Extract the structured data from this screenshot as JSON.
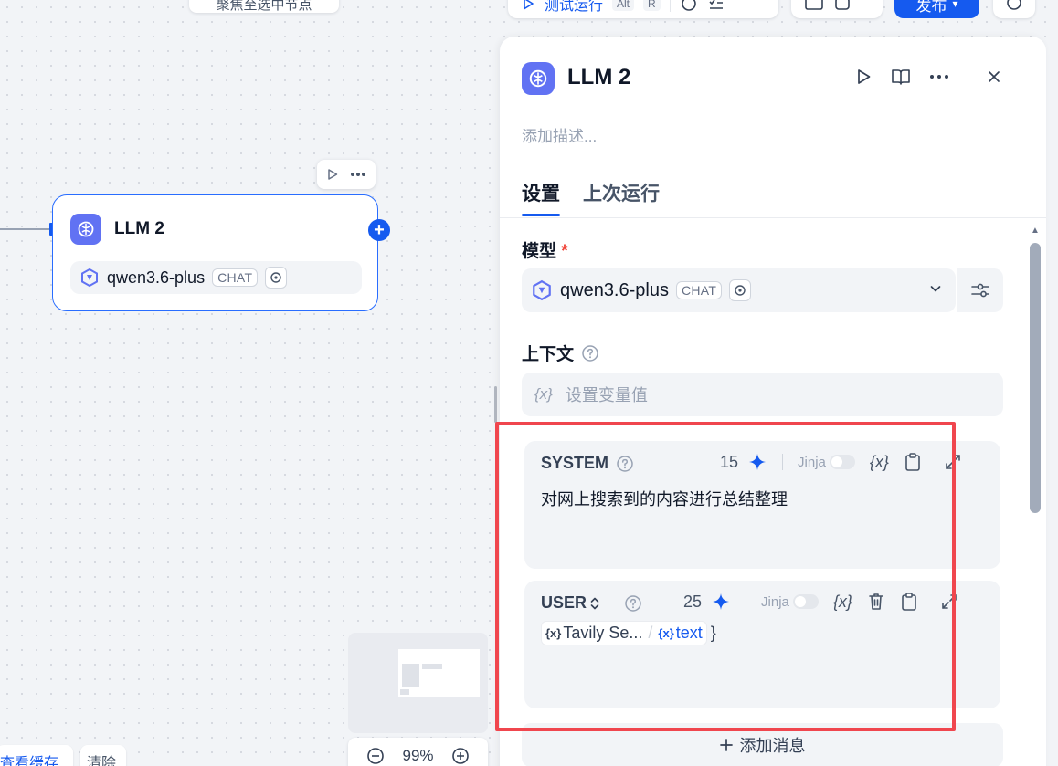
{
  "top": {
    "hint_text": "聚焦至选中节点",
    "run_label": "测试运行",
    "run_shortcut_alt": "Alt",
    "run_shortcut_r": "R",
    "publish_label": "发布"
  },
  "node": {
    "title": "LLM 2",
    "model_name": "qwen3.6-plus",
    "model_badge": "CHAT"
  },
  "canvas": {
    "view_cache_label": "查看缓存",
    "clear_label": "清除",
    "zoom_level": "99%"
  },
  "panel": {
    "title": "LLM 2",
    "description_placeholder": "添加描述...",
    "tabs": [
      "设置",
      "上次运行"
    ],
    "model_label": "模型",
    "required_mark": "*",
    "model_name": "qwen3.6-plus",
    "model_badge": "CHAT",
    "context_label": "上下文",
    "context_placeholder": "设置变量值",
    "add_message_label": "添加消息"
  },
  "messages": [
    {
      "role": "SYSTEM",
      "token_count": "15",
      "jinja_label": "Jinja",
      "content": "对网上搜索到的内容进行总结整理"
    },
    {
      "role": "USER",
      "token_count": "25",
      "jinja_label": "Jinja",
      "var_node": "Tavily Se...",
      "var_name": "text",
      "close_brace": "}"
    }
  ],
  "colors": {
    "accent": "#155aef",
    "node_icon": "#6172f3",
    "highlight": "#f0464e",
    "required": "#f04438"
  }
}
